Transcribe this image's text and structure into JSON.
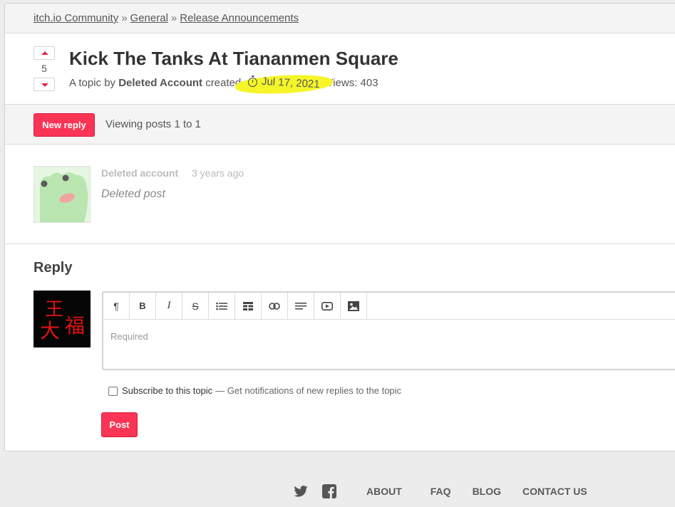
{
  "breadcrumb": {
    "items": [
      "itch.io Community",
      "General",
      "Release Announcements"
    ],
    "separator": "»"
  },
  "topic": {
    "vote_count": "5",
    "title": "Kick The Tanks At Tiananmen Square",
    "meta_prefix": "A topic by",
    "author": "Deleted Account",
    "created_label": "created",
    "date": "Jul 17, 2021",
    "views_label": "Views: 403",
    "highlight_color": "#f5f52a"
  },
  "actions": {
    "new_reply_label": "New reply",
    "viewing_text": "Viewing posts 1 to 1"
  },
  "post": {
    "author": "Deleted account",
    "time": "3 years ago",
    "body": "Deleted post"
  },
  "reply": {
    "heading": "Reply",
    "avatar_text_line1": "王",
    "avatar_text_line2a": "大",
    "avatar_text_line2b": "福",
    "placeholder": "Required",
    "toolbar_icons": [
      "paragraph-icon",
      "bold-icon",
      "italic-icon",
      "strikethrough-icon",
      "bullet-list-icon",
      "table-icon",
      "link-icon",
      "align-icon",
      "video-icon",
      "image-icon"
    ],
    "subscribe_label": "Subscribe to this topic",
    "subscribe_note": "— Get notifications of new replies to the topic",
    "post_label": "Post"
  },
  "footer": {
    "links": [
      "ABOUT",
      "FAQ",
      "BLOG",
      "CONTACT US"
    ]
  },
  "colors": {
    "accent": "#fa3454",
    "background": "#ececec",
    "card": "#ffffff"
  }
}
